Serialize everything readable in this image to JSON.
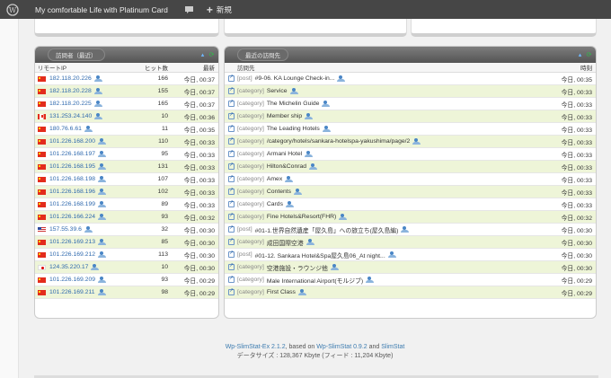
{
  "adminbar": {
    "site_title": "My comfortable Life with Platinum Card",
    "new_label": "新規"
  },
  "visitors": {
    "title": "訪問者（最近）",
    "col_ip": "リモートIP",
    "col_hits": "ヒット数",
    "col_recent": "最新",
    "rows": [
      {
        "flag": "cn",
        "ip": "182.118.20.226",
        "hits": "166",
        "time": "今日, 00:37"
      },
      {
        "flag": "cn",
        "ip": "182.118.20.228",
        "hits": "155",
        "time": "今日, 00:37"
      },
      {
        "flag": "cn",
        "ip": "182.118.20.225",
        "hits": "165",
        "time": "今日, 00:37"
      },
      {
        "flag": "ca",
        "ip": "131.253.24.140",
        "hits": "10",
        "time": "今日, 00:36"
      },
      {
        "flag": "cn",
        "ip": "180.76.6.61",
        "hits": "11",
        "time": "今日, 00:35"
      },
      {
        "flag": "cn",
        "ip": "101.226.168.200",
        "hits": "110",
        "time": "今日, 00:33"
      },
      {
        "flag": "cn",
        "ip": "101.226.168.197",
        "hits": "95",
        "time": "今日, 00:33"
      },
      {
        "flag": "cn",
        "ip": "101.226.168.195",
        "hits": "131",
        "time": "今日, 00:33"
      },
      {
        "flag": "cn",
        "ip": "101.226.168.198",
        "hits": "107",
        "time": "今日, 00:33"
      },
      {
        "flag": "cn",
        "ip": "101.226.168.196",
        "hits": "102",
        "time": "今日, 00:33"
      },
      {
        "flag": "cn",
        "ip": "101.226.168.199",
        "hits": "89",
        "time": "今日, 00:33"
      },
      {
        "flag": "cn",
        "ip": "101.226.166.224",
        "hits": "93",
        "time": "今日, 00:32"
      },
      {
        "flag": "us",
        "ip": "157.55.39.6",
        "hits": "32",
        "time": "今日, 00:30"
      },
      {
        "flag": "cn",
        "ip": "101.226.169.213",
        "hits": "85",
        "time": "今日, 00:30"
      },
      {
        "flag": "cn",
        "ip": "101.226.169.212",
        "hits": "113",
        "time": "今日, 00:30"
      },
      {
        "flag": "jp",
        "ip": "124.35.220.17",
        "hits": "10",
        "time": "今日, 00:30"
      },
      {
        "flag": "cn",
        "ip": "101.226.169.209",
        "hits": "93",
        "time": "今日, 00:29"
      },
      {
        "flag": "cn",
        "ip": "101.226.169.211",
        "hits": "98",
        "time": "今日, 00:29"
      }
    ]
  },
  "pages": {
    "title": "最近の訪問先",
    "col_page": "訪問先",
    "col_time": "時刻",
    "rows": [
      {
        "cat": "[post]",
        "name": "#9-06. KA Lounge Check-in...",
        "time": "今日, 00:35"
      },
      {
        "cat": "[category]",
        "name": "Service",
        "time": "今日, 00:33"
      },
      {
        "cat": "[category]",
        "name": "The Michelin Guide",
        "time": "今日, 00:33"
      },
      {
        "cat": "[category]",
        "name": "Member ship",
        "time": "今日, 00:33"
      },
      {
        "cat": "[category]",
        "name": "The Leading Hotels",
        "time": "今日, 00:33"
      },
      {
        "cat": "[category]",
        "name": "/category/hotels/sankara-hotelspa-yakushima/page/2",
        "time": "今日, 00:33"
      },
      {
        "cat": "[category]",
        "name": "Armani Hotel",
        "time": "今日, 00:33"
      },
      {
        "cat": "[category]",
        "name": "Hilton&Conrad",
        "time": "今日, 00:33"
      },
      {
        "cat": "[category]",
        "name": "Amex",
        "time": "今日, 00:33"
      },
      {
        "cat": "[category]",
        "name": "Contents",
        "time": "今日, 00:33"
      },
      {
        "cat": "[category]",
        "name": "Cards",
        "time": "今日, 00:33"
      },
      {
        "cat": "[category]",
        "name": "Fine Hotels&Resort(FHR)",
        "time": "今日, 00:32"
      },
      {
        "cat": "[post]",
        "name": "#01-1.世界自然遺産「屋久島」への旅立ち(屋久島編)",
        "time": "今日, 00:30"
      },
      {
        "cat": "[category]",
        "name": "成田国際空港",
        "time": "今日, 00:30"
      },
      {
        "cat": "[post]",
        "name": "#01-12. Sankara Hotel&Spa屋久島06_At night...",
        "time": "今日, 00:30"
      },
      {
        "cat": "[category]",
        "name": "空港施設・ラウンジ他",
        "time": "今日, 00:30"
      },
      {
        "cat": "[category]",
        "name": "Male International Airport(モルジブ)",
        "time": "今日, 00:29"
      },
      {
        "cat": "[category]",
        "name": "First Class",
        "time": "今日, 00:29"
      }
    ]
  },
  "footer": {
    "plugin": "Wp-SlimStat-Ex 2.1.2",
    "based": ", based on ",
    "base_plugin": "Wp-SlimStat 0.9.2",
    "and": " and ",
    "slimstat": "SlimStat",
    "datasize": "データサイズ : 128,367 Kbyte (フィード : 11,204 Kbyte)"
  }
}
